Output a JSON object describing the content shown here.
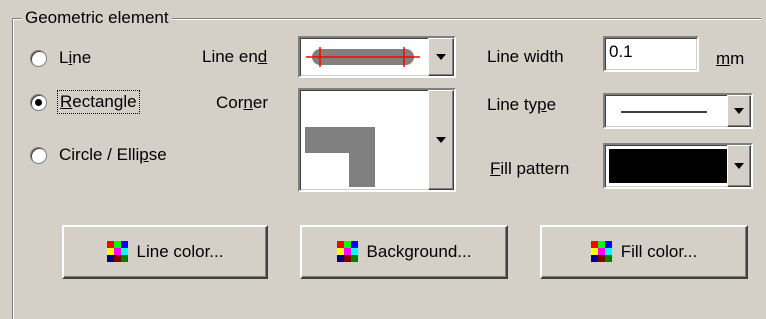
{
  "group": {
    "title": "Geometric element"
  },
  "shape_radios": [
    {
      "label": "Line",
      "checked": false
    },
    {
      "label": "Rectangle",
      "checked": true
    },
    {
      "label": "Circle / Ellipse",
      "checked": false
    }
  ],
  "line_end": {
    "label_pre": "Line en",
    "label_u": "d",
    "label_post": ""
  },
  "corner": {
    "label_pre": "Cor",
    "label_u": "n",
    "label_post": "er"
  },
  "line_width": {
    "label": "Line width",
    "value": "0.1",
    "unit": "mm",
    "unit_u": "m",
    "unit_post": "m"
  },
  "line_type": {
    "label_pre": "Line ty",
    "label_u": "p",
    "label_post": "e"
  },
  "fill_pattern": {
    "label_u": "F",
    "label_post": "ill pattern",
    "color": "#000000"
  },
  "buttons": {
    "line_color": "Line color...",
    "background": "Background...",
    "fill_color": "Fill color..."
  },
  "colors": {
    "background": "#d4d0c8",
    "line_end_bar": "#808080",
    "line_end_cross": "#ff0000",
    "corner_fill": "#808080"
  },
  "icons": {
    "palette": "color-palette-icon",
    "dropdown": "chevron-down-icon"
  }
}
